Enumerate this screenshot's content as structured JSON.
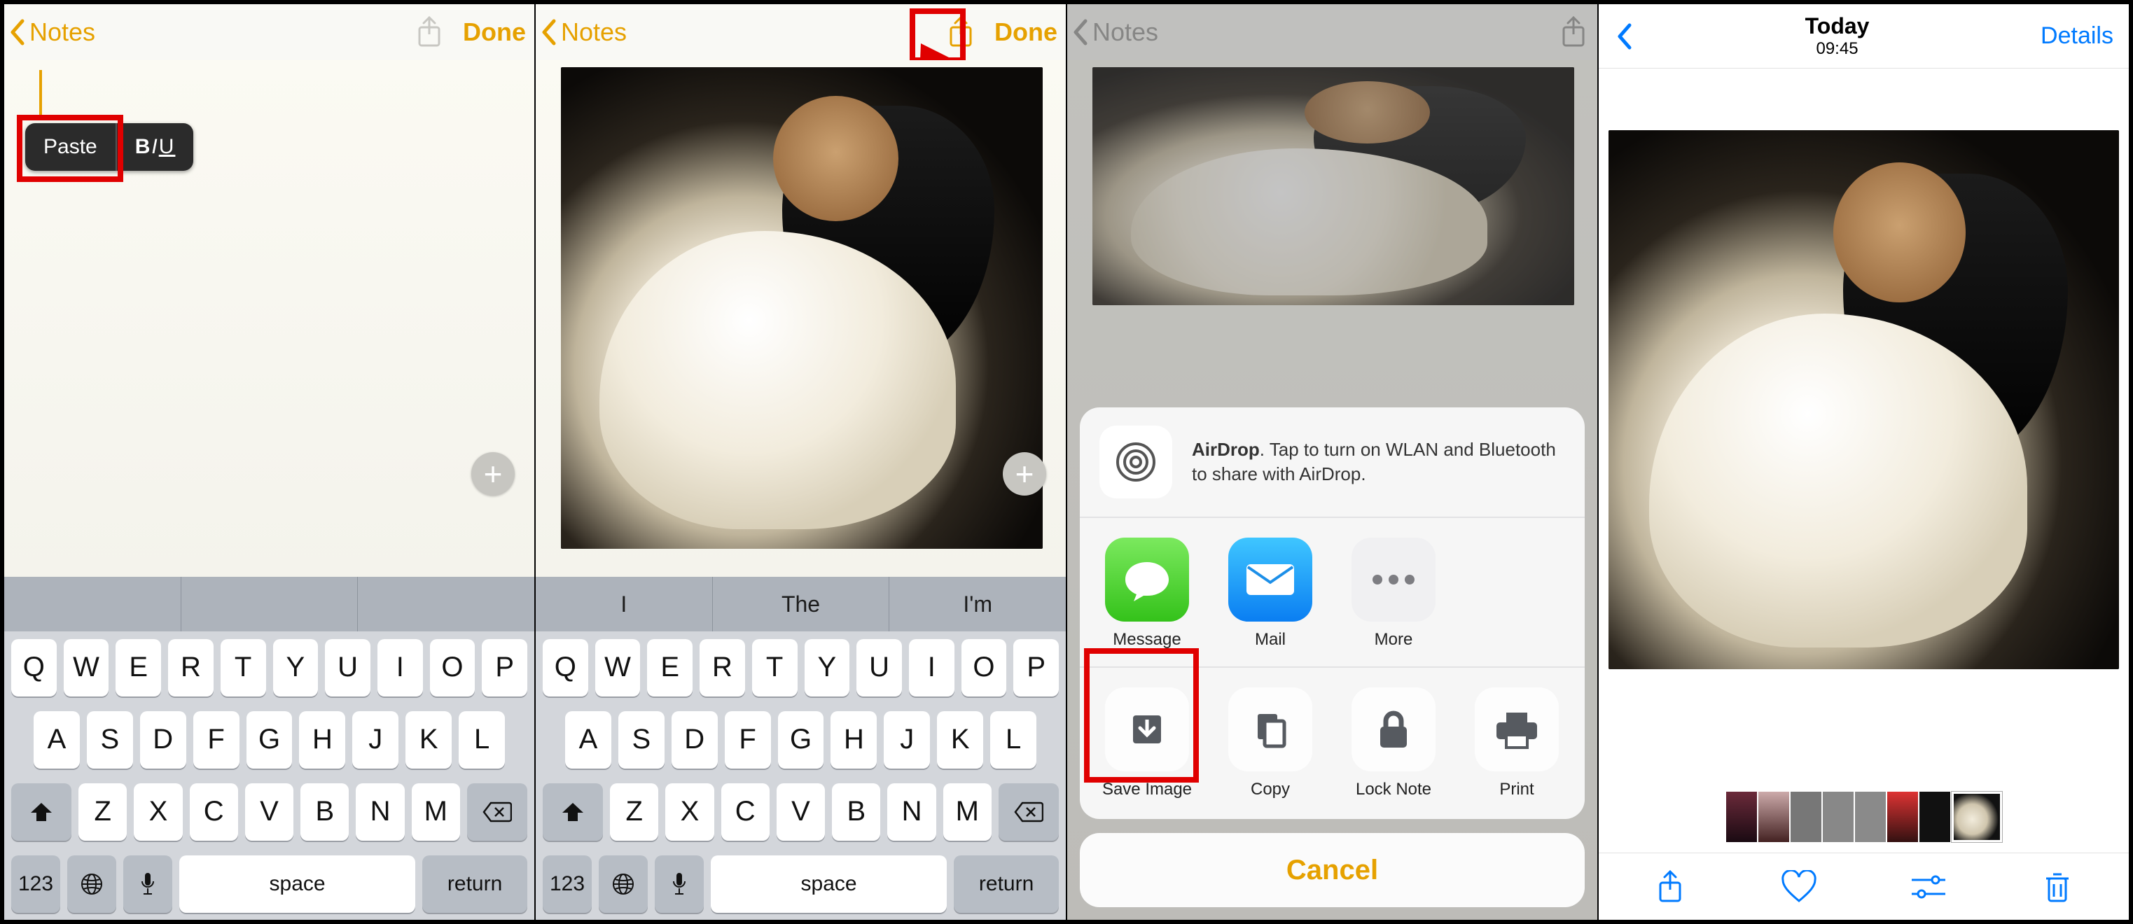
{
  "colors": {
    "notes_accent": "#e6a100",
    "ios_blue": "#007aff",
    "highlight_red": "#e00000"
  },
  "panel1": {
    "back_label": "Notes",
    "done_label": "Done",
    "menu": {
      "paste": "Paste",
      "biu_b": "B",
      "biu_i": "I",
      "biu_u": "U"
    },
    "predictions": [
      "",
      "",
      ""
    ]
  },
  "panel2": {
    "back_label": "Notes",
    "done_label": "Done",
    "predictions": [
      "I",
      "The",
      "I'm"
    ]
  },
  "keyboard": {
    "row1": [
      "Q",
      "W",
      "E",
      "R",
      "T",
      "Y",
      "U",
      "I",
      "O",
      "P"
    ],
    "row2": [
      "A",
      "S",
      "D",
      "F",
      "G",
      "H",
      "J",
      "K",
      "L"
    ],
    "row3": [
      "Z",
      "X",
      "C",
      "V",
      "B",
      "N",
      "M"
    ],
    "mods": {
      "numbers": "123",
      "space": "space",
      "return": "return"
    }
  },
  "panel3": {
    "back_label": "Notes",
    "airdrop_bold": "AirDrop",
    "airdrop_text": ". Tap to turn on WLAN and Bluetooth to share with AirDrop.",
    "share_actions": [
      {
        "id": "message",
        "label": "Message"
      },
      {
        "id": "mail",
        "label": "Mail"
      },
      {
        "id": "more",
        "label": "More"
      }
    ],
    "local_actions": [
      {
        "id": "save-image",
        "label": "Save Image"
      },
      {
        "id": "copy",
        "label": "Copy"
      },
      {
        "id": "lock-note",
        "label": "Lock Note"
      },
      {
        "id": "print",
        "label": "Print"
      }
    ],
    "cancel": "Cancel"
  },
  "panel4": {
    "title": "Today",
    "subtitle": "09:45",
    "details": "Details"
  }
}
